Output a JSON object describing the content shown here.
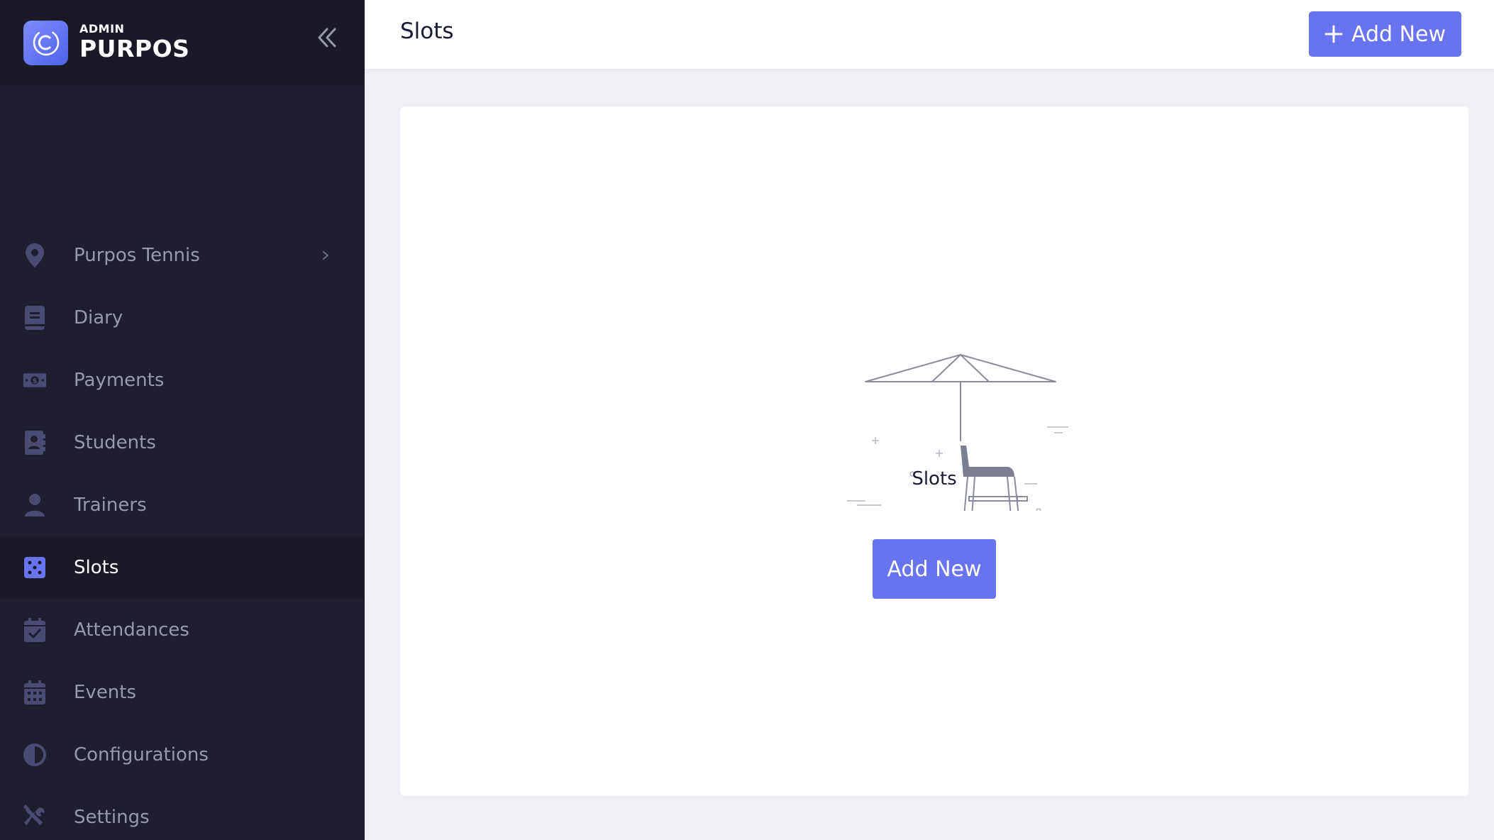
{
  "brand": {
    "top": "ADMIN",
    "name": "PURPOS",
    "accent": "#6674f0"
  },
  "sidebar": {
    "items": [
      {
        "label": "Purpos Tennis",
        "icon": "location-pin-icon",
        "has_arrow": true
      },
      {
        "label": "Diary",
        "icon": "book-icon"
      },
      {
        "label": "Payments",
        "icon": "banknote-icon"
      },
      {
        "label": "Students",
        "icon": "contact-book-icon"
      },
      {
        "label": "Trainers",
        "icon": "user-icon"
      },
      {
        "label": "Slots",
        "icon": "grid-dots-icon",
        "active": true
      },
      {
        "label": "Attendances",
        "icon": "calendar-check-icon"
      },
      {
        "label": "Events",
        "icon": "calendar-icon"
      },
      {
        "label": "Configurations",
        "icon": "half-circle-icon"
      },
      {
        "label": "Settings",
        "icon": "tools-icon"
      }
    ]
  },
  "header": {
    "title": "Slots",
    "add_button_label": "Add New"
  },
  "empty_state": {
    "label": "Slots",
    "button_label": "Add New",
    "illustration": "lifeguard-chair-umbrella-illustration"
  },
  "colors": {
    "sidebar_bg": "#1e1e2e",
    "sidebar_active_bg": "#1a1a27",
    "nav_text": "#9899ac",
    "icon_muted": "#494b74",
    "icon_active": "#6674f0",
    "button": "#6674f0",
    "page_bg": "#eef0f5"
  }
}
